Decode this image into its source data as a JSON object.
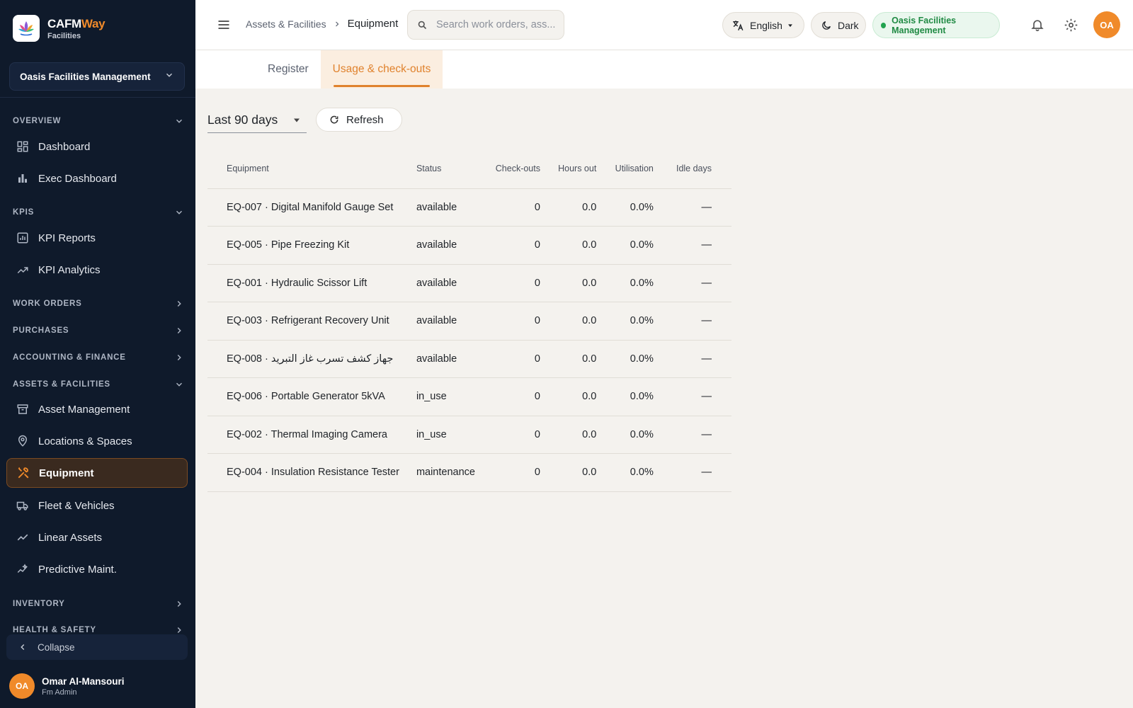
{
  "brand": {
    "name_part1": "CAFM",
    "name_part2": "Way",
    "subtitle": "Facilities"
  },
  "org_selector": {
    "selected": "Oasis Facilities Management"
  },
  "sidebar": {
    "sections": {
      "overview": "OVERVIEW",
      "kpis": "KPIS",
      "work_orders": "WORK ORDERS",
      "purchases": "PURCHASES",
      "accounting": "ACCOUNTING & FINANCE",
      "assets": "ASSETS & FACILITIES",
      "inventory": "INVENTORY",
      "health_safety": "HEALTH & SAFETY"
    },
    "items": {
      "dashboard": "Dashboard",
      "exec_dashboard": "Exec Dashboard",
      "kpi_reports": "KPI Reports",
      "kpi_analytics": "KPI Analytics",
      "asset_management": "Asset Management",
      "locations": "Locations & Spaces",
      "equipment": "Equipment",
      "fleet": "Fleet & Vehicles",
      "linear_assets": "Linear Assets",
      "predictive": "Predictive Maint."
    },
    "collapse_label": "Collapse",
    "user": {
      "initials": "OA",
      "name": "Omar Al-Mansouri",
      "role": "Fm Admin"
    }
  },
  "topbar": {
    "breadcrumb": {
      "parent": "Assets & Facilities",
      "current": "Equipment"
    },
    "search_placeholder": "Search work orders, ass...",
    "language": "English",
    "theme_toggle": "Dark",
    "org_badge": "Oasis Facilities Management",
    "avatar_initials": "OA"
  },
  "tabs": {
    "register": "Register",
    "usage": "Usage & check-outs"
  },
  "filters": {
    "period": "Last 90 days",
    "refresh_label": "Refresh"
  },
  "table": {
    "headers": {
      "equipment": "Equipment",
      "status": "Status",
      "checkouts": "Check-outs",
      "hours_out": "Hours out",
      "utilisation": "Utilisation",
      "idle_days": "Idle days"
    },
    "rows": [
      {
        "equipment": "EQ-007 · Digital Manifold Gauge Set",
        "status": "available",
        "checkouts": "0",
        "hours": "0.0",
        "util": "0.0%",
        "idle": "—"
      },
      {
        "equipment": "EQ-005 · Pipe Freezing Kit",
        "status": "available",
        "checkouts": "0",
        "hours": "0.0",
        "util": "0.0%",
        "idle": "—"
      },
      {
        "equipment": "EQ-001 · Hydraulic Scissor Lift",
        "status": "available",
        "checkouts": "0",
        "hours": "0.0",
        "util": "0.0%",
        "idle": "—"
      },
      {
        "equipment": "EQ-003 · Refrigerant Recovery Unit",
        "status": "available",
        "checkouts": "0",
        "hours": "0.0",
        "util": "0.0%",
        "idle": "—"
      },
      {
        "equipment": "EQ-008 · جهاز كشف تسرب غاز التبريد",
        "status": "available",
        "checkouts": "0",
        "hours": "0.0",
        "util": "0.0%",
        "idle": "—"
      },
      {
        "equipment": "EQ-006 · Portable Generator 5kVA",
        "status": "in_use",
        "checkouts": "0",
        "hours": "0.0",
        "util": "0.0%",
        "idle": "—"
      },
      {
        "equipment": "EQ-002 · Thermal Imaging Camera",
        "status": "in_use",
        "checkouts": "0",
        "hours": "0.0",
        "util": "0.0%",
        "idle": "—"
      },
      {
        "equipment": "EQ-004 · Insulation Resistance Tester",
        "status": "maintenance",
        "checkouts": "0",
        "hours": "0.0",
        "util": "0.0%",
        "idle": "—"
      }
    ]
  },
  "colors": {
    "sidebar_bg": "#0f1a2b",
    "accent": "#f08a2a",
    "active_tab": "#e0822d",
    "org_badge_green": "#1f8a43",
    "content_bg": "#f4f2ee"
  },
  "icons": {
    "logo": "lotus-logo-icon",
    "dashboard": "grid-icon",
    "exec_dashboard": "bar-chart-icon",
    "kpi_reports": "report-icon",
    "kpi_analytics": "trending-icon",
    "asset_management": "archive-icon",
    "locations": "pin-icon",
    "equipment": "tools-icon",
    "fleet": "truck-icon",
    "linear_assets": "line-chart-icon",
    "predictive": "sparkline-icon"
  }
}
